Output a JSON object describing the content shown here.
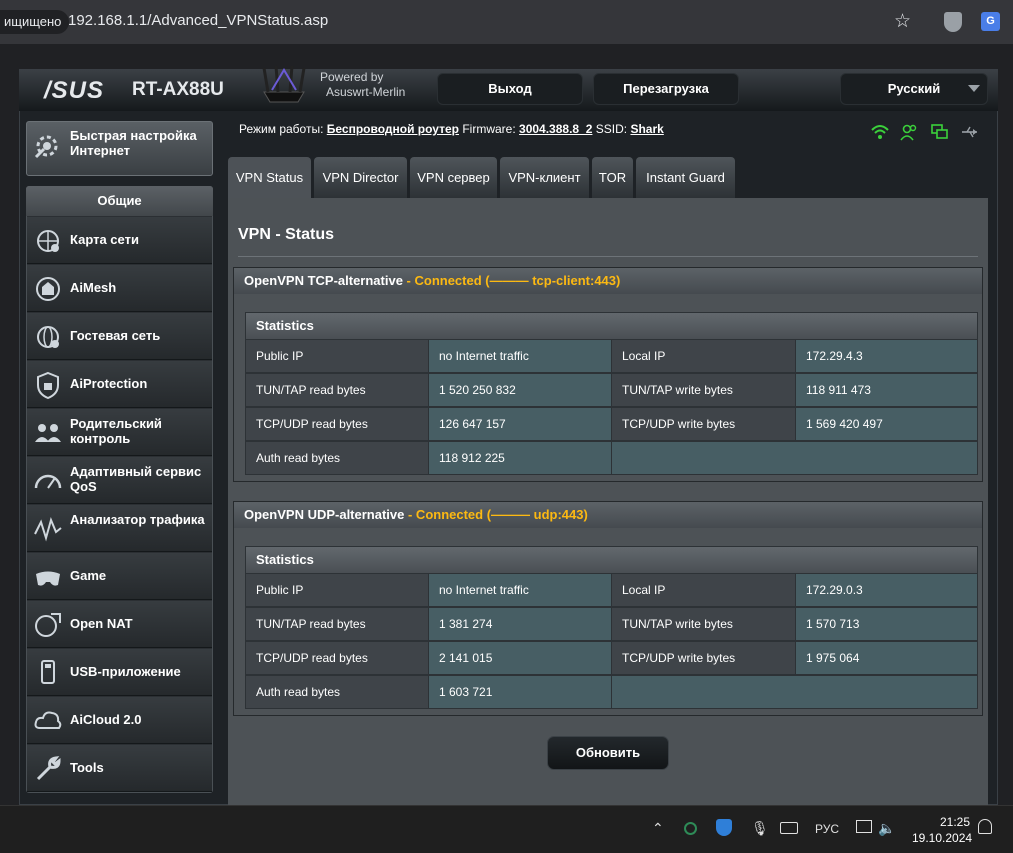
{
  "browser": {
    "secure_label": "ищищено",
    "url": "192.168.1.1/Advanced_VPNStatus.asp"
  },
  "header": {
    "brand": "/SUS",
    "model": "RT-AX88U",
    "powered_by_line1": "Powered by",
    "powered_by_line2": "Asuswrt-Merlin",
    "logout": "Выход",
    "reboot": "Перезагрузка",
    "language": "Русский"
  },
  "status": {
    "mode_label": "Режим работы:",
    "mode_value": "Беспроводной роутер",
    "firmware_label": "Firmware:",
    "firmware_value": "3004.388.8_2",
    "ssid_label": "SSID:",
    "ssid_value": "Shark"
  },
  "sidebar": {
    "quick_setup": "Быстрая настройка Интернет",
    "section_title": "Общие",
    "items": [
      {
        "label": "Карта сети",
        "icon": "network-map-icon"
      },
      {
        "label": "AiMesh",
        "icon": "aimesh-icon"
      },
      {
        "label": "Гостевая сеть",
        "icon": "guest-network-icon"
      },
      {
        "label": "AiProtection",
        "icon": "aiprotection-icon"
      },
      {
        "label": "Родительский контроль",
        "icon": "parental-control-icon"
      },
      {
        "label": "Адаптивный сервис QoS",
        "icon": "qos-icon"
      },
      {
        "label": "Анализатор трафика",
        "icon": "traffic-analyzer-icon"
      },
      {
        "label": "Game",
        "icon": "game-icon"
      },
      {
        "label": "Open NAT",
        "icon": "open-nat-icon"
      },
      {
        "label": "USB-приложение",
        "icon": "usb-app-icon"
      },
      {
        "label": "AiCloud 2.0",
        "icon": "aicloud-icon"
      },
      {
        "label": "Tools",
        "icon": "tools-icon"
      }
    ]
  },
  "tabs": [
    "VPN Status",
    "VPN Director",
    "VPN сервер",
    "VPN-клиент",
    "TOR",
    "Instant Guard"
  ],
  "page_title": "VPN - Status",
  "panels": [
    {
      "name": "OpenVPN TCP-alternative",
      "state": " - Connected (——— tcp-client:443)",
      "stats_title": "Statistics",
      "rows": [
        [
          "Public IP",
          "no Internet traffic",
          "Local IP",
          "172.29.4.3"
        ],
        [
          "TUN/TAP read bytes",
          "1 520 250 832",
          "TUN/TAP write bytes",
          "118 911 473"
        ],
        [
          "TCP/UDP read bytes",
          "126 647 157",
          "TCP/UDP write bytes",
          "1 569 420 497"
        ],
        [
          "Auth read bytes",
          "118 912 225",
          "",
          ""
        ]
      ]
    },
    {
      "name": "OpenVPN UDP-alternative",
      "state": " - Connected (——— udp:443)",
      "stats_title": "Statistics",
      "rows": [
        [
          "Public IP",
          "no Internet traffic",
          "Local IP",
          "172.29.0.3"
        ],
        [
          "TUN/TAP read bytes",
          "1 381 274",
          "TUN/TAP write bytes",
          "1 570 713"
        ],
        [
          "TCP/UDP read bytes",
          "2 141 015",
          "TCP/UDP write bytes",
          "1 975 064"
        ],
        [
          "Auth read bytes",
          "1 603 721",
          "",
          ""
        ]
      ]
    }
  ],
  "refresh": "Обновить",
  "taskbar": {
    "language": "РУС",
    "time": "21:25",
    "date": "19.10.2024"
  },
  "colors": {
    "accent_status": "#fcb912",
    "value_cell": "#475e64"
  }
}
